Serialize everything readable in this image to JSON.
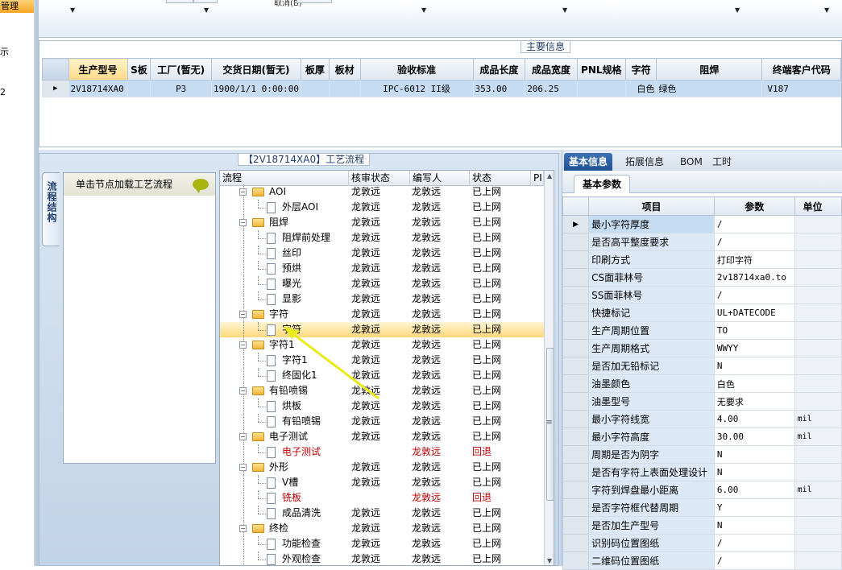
{
  "left_nav": {
    "header": "管理",
    "items": [
      "示",
      "2"
    ]
  },
  "toolbar": {
    "label": "取消(B)"
  },
  "main_info": {
    "title": "主要信息",
    "columns": [
      "生产型号",
      "S板",
      "工厂(暂无)",
      "交货日期(暂无)",
      "板厚",
      "板材",
      "验收标准",
      "成品长度",
      "成品宽度",
      "PNL规格",
      "字符",
      "阻焊",
      "终端客户代码"
    ],
    "row": [
      "2V18714XA0",
      "",
      "P3",
      "1900/1/1 0:00:00",
      "",
      "",
      "IPC-6012 II级",
      "353.00",
      "206.25",
      "",
      "白色",
      "绿色",
      "V187"
    ]
  },
  "flow": {
    "title": "【2V18714XA0】工艺流程",
    "vertical_tab": "流程结构",
    "node_hint": "单击节点加载工艺流程",
    "columns": [
      "流程",
      "核审状态",
      "编写人",
      "状态",
      "PI"
    ],
    "rows": [
      {
        "label": "AOI",
        "level": 0,
        "review": "龙敦远",
        "author": "龙敦远",
        "status": "已上网",
        "red": false
      },
      {
        "label": "外层AOI",
        "level": 1,
        "review": "龙敦远",
        "author": "龙敦远",
        "status": "已上网",
        "red": false
      },
      {
        "label": "阻焊",
        "level": 0,
        "review": "龙敦远",
        "author": "龙敦远",
        "status": "已上网",
        "red": false
      },
      {
        "label": "阻焊前处理",
        "level": 1,
        "review": "龙敦远",
        "author": "龙敦远",
        "status": "已上网",
        "red": false
      },
      {
        "label": "丝印",
        "level": 1,
        "review": "龙敦远",
        "author": "龙敦远",
        "status": "已上网",
        "red": false
      },
      {
        "label": "预烘",
        "level": 1,
        "review": "龙敦远",
        "author": "龙敦远",
        "status": "已上网",
        "red": false
      },
      {
        "label": "曝光",
        "level": 1,
        "review": "龙敦远",
        "author": "龙敦远",
        "status": "已上网",
        "red": false
      },
      {
        "label": "显影",
        "level": 1,
        "review": "龙敦远",
        "author": "龙敦远",
        "status": "已上网",
        "red": false
      },
      {
        "label": "字符",
        "level": 0,
        "review": "龙敦远",
        "author": "龙敦远",
        "status": "已上网",
        "red": false
      },
      {
        "label": "字符",
        "level": 1,
        "review": "龙敦远",
        "author": "龙敦远",
        "status": "已上网",
        "red": false,
        "selected": true
      },
      {
        "label": "字符1",
        "level": 0,
        "review": "龙敦远",
        "author": "龙敦远",
        "status": "已上网",
        "red": false
      },
      {
        "label": "字符1",
        "level": 1,
        "review": "龙敦远",
        "author": "龙敦远",
        "status": "已上网",
        "red": false
      },
      {
        "label": "终固化1",
        "level": 1,
        "review": "龙敦远",
        "author": "龙敦远",
        "status": "已上网",
        "red": false
      },
      {
        "label": "有铅喷锡",
        "level": 0,
        "review": "龙敦远",
        "author": "龙敦远",
        "status": "已上网",
        "red": false
      },
      {
        "label": "烘板",
        "level": 1,
        "review": "龙敦远",
        "author": "龙敦远",
        "status": "已上网",
        "red": false
      },
      {
        "label": "有铅喷锡",
        "level": 1,
        "review": "龙敦远",
        "author": "龙敦远",
        "status": "已上网",
        "red": false
      },
      {
        "label": "电子测试",
        "level": 0,
        "review": "龙敦远",
        "author": "龙敦远",
        "status": "已上网",
        "red": false
      },
      {
        "label": "电子测试",
        "level": 1,
        "review": "",
        "author": "龙敦远",
        "status": "回退",
        "red": true
      },
      {
        "label": "外形",
        "level": 0,
        "review": "龙敦远",
        "author": "龙敦远",
        "status": "已上网",
        "red": false
      },
      {
        "label": "V槽",
        "level": 1,
        "review": "龙敦远",
        "author": "龙敦远",
        "status": "已上网",
        "red": false
      },
      {
        "label": "铣板",
        "level": 1,
        "review": "",
        "author": "龙敦远",
        "status": "回退",
        "red": true
      },
      {
        "label": "成品清洗",
        "level": 1,
        "review": "龙敦远",
        "author": "龙敦远",
        "status": "已上网",
        "red": false
      },
      {
        "label": "终检",
        "level": 0,
        "review": "龙敦远",
        "author": "龙敦远",
        "status": "已上网",
        "red": false
      },
      {
        "label": "功能检查",
        "level": 1,
        "review": "龙敦远",
        "author": "龙敦远",
        "status": "已上网",
        "red": false
      },
      {
        "label": "外观检查",
        "level": 1,
        "review": "龙敦远",
        "author": "龙敦远",
        "status": "已上网",
        "red": false
      }
    ]
  },
  "right": {
    "tabs": [
      "基本信息",
      "拓展信息",
      "BOM",
      "工时"
    ],
    "active_tab": "基本信息",
    "subtab": "基本参数",
    "columns": [
      "项目",
      "参数",
      "单位"
    ],
    "rows": [
      [
        "最小字符厚度",
        "/",
        ""
      ],
      [
        "是否高平整度要求",
        "/",
        ""
      ],
      [
        "印刷方式",
        "打印字符",
        ""
      ],
      [
        "CS面菲林号",
        "2v18714xa0.to",
        ""
      ],
      [
        "SS面菲林号",
        "/",
        ""
      ],
      [
        "快捷标记",
        "UL+DATECODE",
        ""
      ],
      [
        "生产周期位置",
        "TO",
        ""
      ],
      [
        "生产周期格式",
        "WWYY",
        ""
      ],
      [
        "是否加无铅标记",
        "N",
        ""
      ],
      [
        "油墨颜色",
        "白色",
        ""
      ],
      [
        "油墨型号",
        "无要求",
        ""
      ],
      [
        "最小字符线宽",
        "4.00",
        "mil"
      ],
      [
        "最小字符高度",
        "30.00",
        "mil"
      ],
      [
        "周期是否为阴字",
        "N",
        ""
      ],
      [
        "是否有字符上表面处理设计",
        "N",
        ""
      ],
      [
        "字符到焊盘最小距离",
        "6.00",
        "mil"
      ],
      [
        "是否字符框代替周期",
        "Y",
        ""
      ],
      [
        "是否加生产型号",
        "N",
        ""
      ],
      [
        "识别码位置图纸",
        "/",
        ""
      ],
      [
        "二维码位置图纸",
        "/",
        ""
      ]
    ]
  },
  "colors": {
    "accent": "#1e4f93",
    "selected_row": "#c6dcf3",
    "highlight": "#ffd87a",
    "rollback": "#c00000",
    "arrow": "#f0f020"
  }
}
